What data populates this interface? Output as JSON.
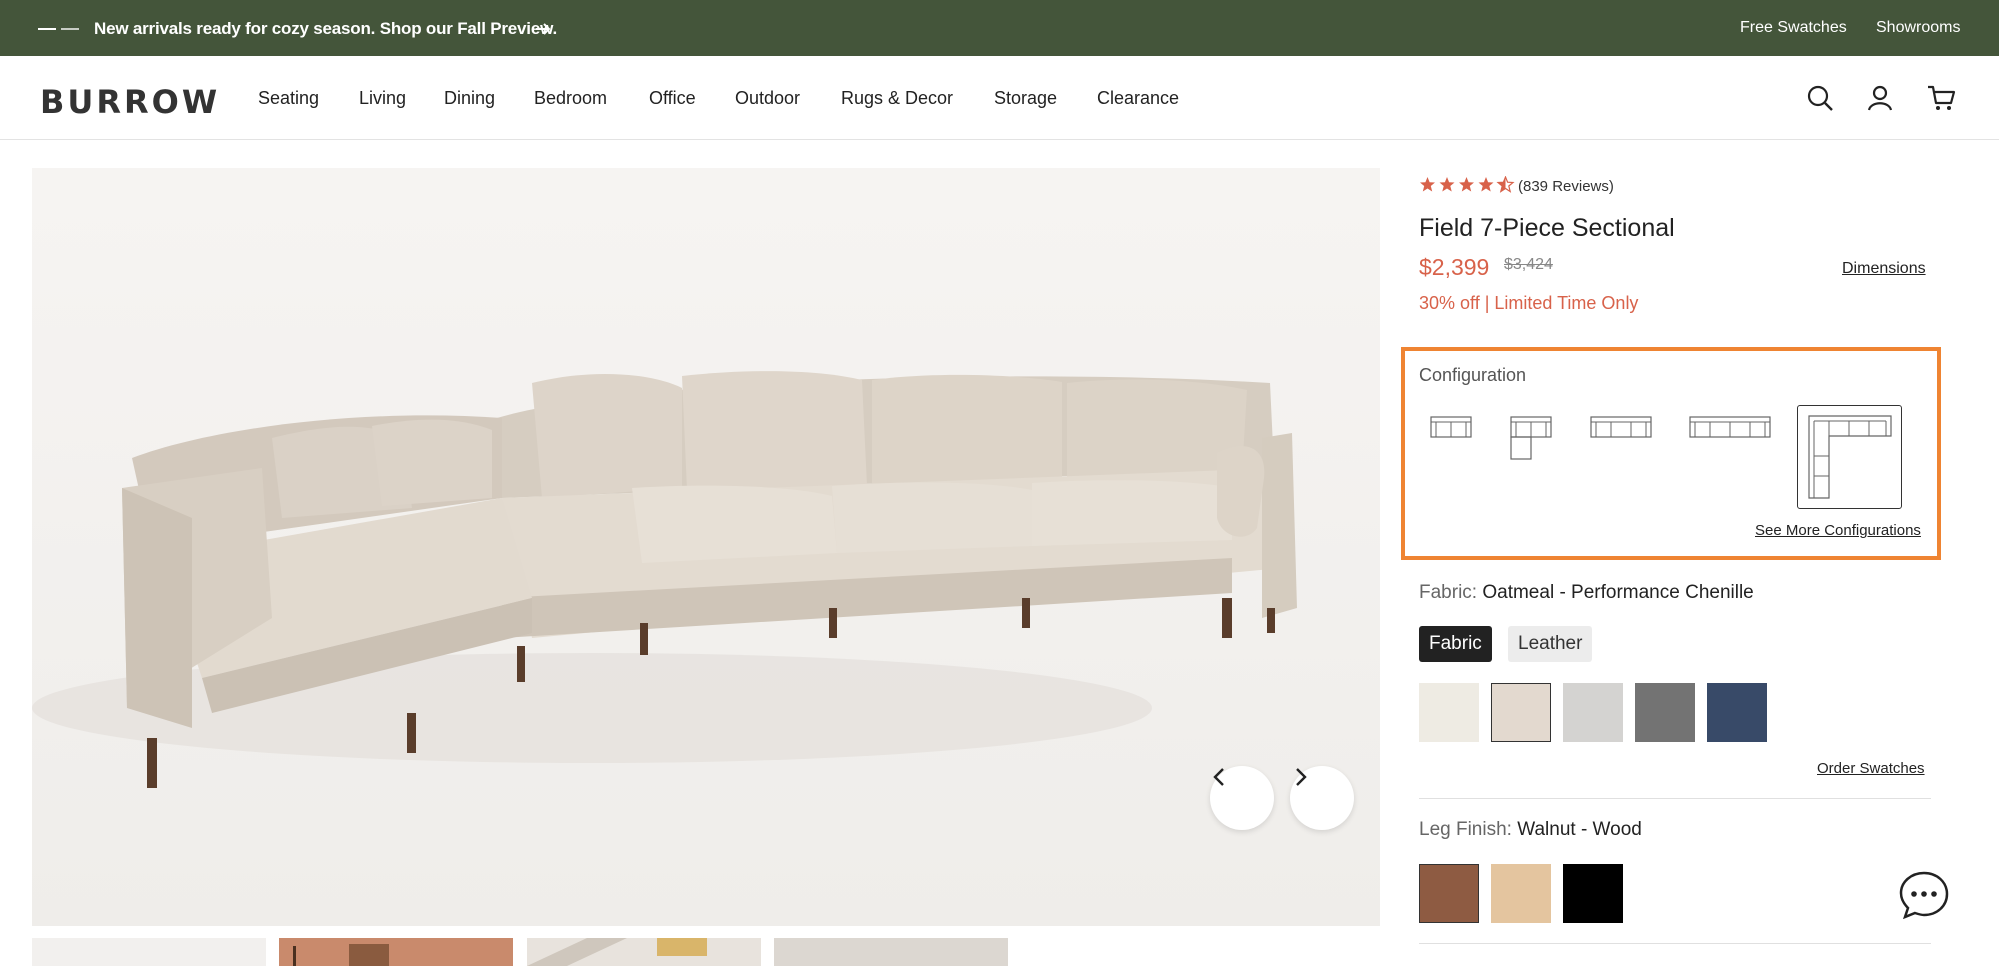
{
  "announcement": {
    "message": "New arrivals ready for cozy season. Shop our Fall Preview.",
    "links": [
      "Free Swatches",
      "Showrooms"
    ]
  },
  "header": {
    "logo": "BURROW",
    "nav": [
      "Seating",
      "Living",
      "Dining",
      "Bedroom",
      "Office",
      "Outdoor",
      "Rugs & Decor",
      "Storage",
      "Clearance"
    ],
    "icons": [
      "search-icon",
      "account-icon",
      "cart-icon"
    ]
  },
  "product": {
    "rating": 4.5,
    "reviews": "(839 Reviews)",
    "title": "Field 7-Piece Sectional",
    "price": "$2,399",
    "original_price": "$3,424",
    "dimensions_link": "Dimensions",
    "promo": "30% off | Limited Time Only"
  },
  "configuration": {
    "label": "Configuration",
    "options": [
      "loveseat",
      "chaise-sectional",
      "sofa",
      "extended-sofa",
      "corner-sectional"
    ],
    "selected": "corner-sectional",
    "see_more": "See More Configurations"
  },
  "fabric": {
    "label": "Fabric:",
    "value": "Oatmeal - Performance Chenille",
    "tabs": [
      "Fabric",
      "Leather"
    ],
    "active_tab": "Fabric",
    "swatches": [
      "#eeebe3",
      "#e3d9cf",
      "#d4d3d1",
      "#737373",
      "#384a68"
    ],
    "selected_swatch": 1,
    "order_swatches": "Order Swatches"
  },
  "leg_finish": {
    "label": "Leg Finish:",
    "value": "Walnut - Wood",
    "swatches": [
      "#8e5b42",
      "#e4c59f",
      "#000000"
    ],
    "selected_swatch": 0
  },
  "colors": {
    "accent": "#d8624a",
    "banner": "#44553a",
    "highlight": "#ef8432"
  }
}
